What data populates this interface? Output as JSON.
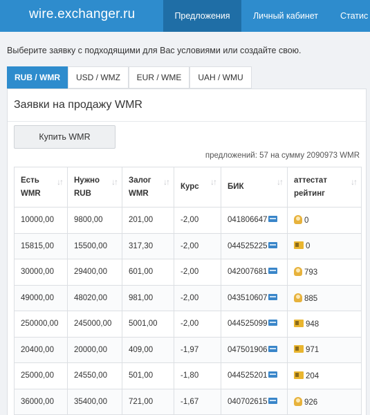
{
  "header": {
    "brand": "wire.exchanger.ru",
    "nav": [
      {
        "label": "Предложения",
        "active": true
      },
      {
        "label": "Личный кабинет",
        "active": false
      },
      {
        "label": "Статис",
        "active": false
      }
    ]
  },
  "intro_text": "Выберите заявку с подходящими для Вас условиями или создайте свою.",
  "tabs": [
    {
      "label": "RUB / WMR",
      "active": true
    },
    {
      "label": "USD / WMZ",
      "active": false
    },
    {
      "label": "EUR / WME",
      "active": false
    },
    {
      "label": "UAH / WMU",
      "active": false
    }
  ],
  "panel": {
    "title": "Заявки на продажу WMR",
    "buy_button": "Купить WMR",
    "summary": "предложений: 57 на сумму 2090973 WMR"
  },
  "table": {
    "columns": [
      {
        "line1": "Есть",
        "line2": "WMR",
        "sortable": true
      },
      {
        "line1": "Нужно",
        "line2": "RUB",
        "sortable": true
      },
      {
        "line1": "Залог",
        "line2": "WMR",
        "sortable": true
      },
      {
        "line1": "Курс",
        "line2": "",
        "sortable": true
      },
      {
        "line1": "БИК",
        "line2": "",
        "sortable": true
      },
      {
        "line1": "аттестат",
        "line2": "рейтинг",
        "sortable": true
      }
    ],
    "rows": [
      {
        "have": "10000,00",
        "need": "9800,00",
        "deposit": "201,00",
        "rate": "-2,00",
        "bik": "041806647",
        "cert": "personal-icon",
        "rating": "0"
      },
      {
        "have": "15815,00",
        "need": "15500,00",
        "deposit": "317,30",
        "rate": "-2,00",
        "bik": "044525225",
        "cert": "formal-icon",
        "rating": "0"
      },
      {
        "have": "30000,00",
        "need": "29400,00",
        "deposit": "601,00",
        "rate": "-2,00",
        "bik": "042007681",
        "cert": "personal-icon",
        "rating": "793"
      },
      {
        "have": "49000,00",
        "need": "48020,00",
        "deposit": "981,00",
        "rate": "-2,00",
        "bik": "043510607",
        "cert": "personal-icon",
        "rating": "885"
      },
      {
        "have": "250000,00",
        "need": "245000,00",
        "deposit": "5001,00",
        "rate": "-2,00",
        "bik": "044525099",
        "cert": "formal-icon",
        "rating": "948"
      },
      {
        "have": "20400,00",
        "need": "20000,00",
        "deposit": "409,00",
        "rate": "-1,97",
        "bik": "047501906",
        "cert": "formal-icon",
        "rating": "971"
      },
      {
        "have": "25000,00",
        "need": "24550,00",
        "deposit": "501,00",
        "rate": "-1,80",
        "bik": "044525201",
        "cert": "formal-icon",
        "rating": "204"
      },
      {
        "have": "36000,00",
        "need": "35400,00",
        "deposit": "721,00",
        "rate": "-1,67",
        "bik": "040702615",
        "cert": "personal-icon",
        "rating": "926"
      }
    ]
  },
  "colors": {
    "header_bg": "#2e8ccd",
    "nav_active_bg": "#1f6ea6",
    "rate_text": "#2e7bc4",
    "cert_gold": "#e7b23c",
    "card_blue": "#3a86c9"
  }
}
